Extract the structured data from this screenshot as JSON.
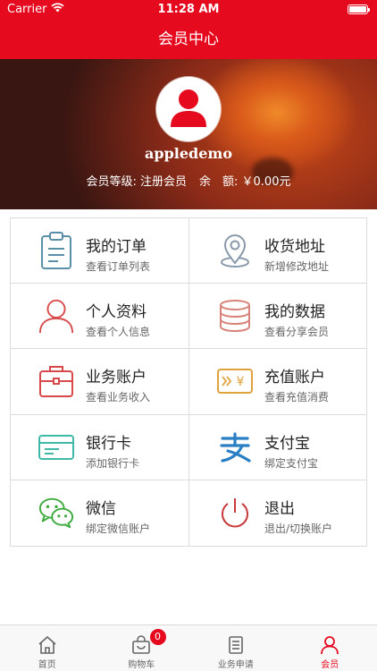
{
  "status_bar": {
    "carrier": "Carrier",
    "time": "11:28 AM"
  },
  "nav": {
    "title": "会员中心"
  },
  "profile": {
    "username": "appledemo",
    "level_label": "会员等级: 注册会员",
    "balance_label": "余　额: ￥0.00元"
  },
  "menu": [
    {
      "title": "我的订单",
      "subtitle": "查看订单列表",
      "icon": "clipboard-icon",
      "color": "#5a8fa8"
    },
    {
      "title": "收货地址",
      "subtitle": "新增修改地址",
      "icon": "location-pin-icon",
      "color": "#8a9aab"
    },
    {
      "title": "个人资料",
      "subtitle": "查看个人信息",
      "icon": "person-icon",
      "color": "#d84a4a"
    },
    {
      "title": "我的数据",
      "subtitle": "查看分享会员",
      "icon": "database-icon",
      "color": "#d8847a"
    },
    {
      "title": "业务账户",
      "subtitle": "查看业务收入",
      "icon": "briefcase-icon",
      "color": "#d8474a"
    },
    {
      "title": "充值账户",
      "subtitle": "查看充值消费",
      "icon": "recharge-card-icon",
      "color": "#e0a23a"
    },
    {
      "title": "银行卡",
      "subtitle": "添加银行卡",
      "icon": "bank-card-icon",
      "color": "#3fb8a8"
    },
    {
      "title": "支付宝",
      "subtitle": "绑定支付宝",
      "icon": "alipay-icon",
      "color": "#2a7fc4"
    },
    {
      "title": "微信",
      "subtitle": "绑定微信账户",
      "icon": "wechat-icon",
      "color": "#3caa3c"
    },
    {
      "title": "退出",
      "subtitle": "退出/切换账户",
      "icon": "power-icon",
      "color": "#c83a3a"
    }
  ],
  "tabs": [
    {
      "label": "首页",
      "icon": "home-icon",
      "active": false
    },
    {
      "label": "购物车",
      "icon": "shopping-bag-icon",
      "active": false,
      "badge": "0"
    },
    {
      "label": "业务申请",
      "icon": "document-icon",
      "active": false
    },
    {
      "label": "会员",
      "icon": "user-icon",
      "active": true
    }
  ],
  "colors": {
    "brand": "#e60a1e",
    "divider": "#dcdcdc"
  }
}
